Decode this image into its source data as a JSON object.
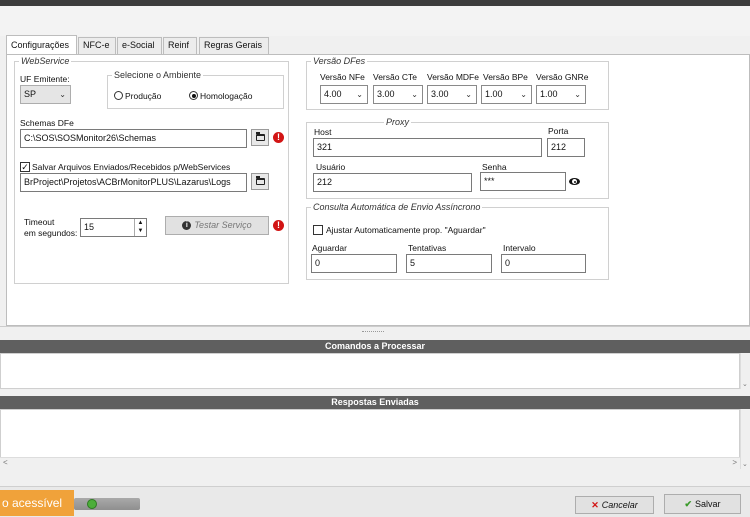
{
  "tabs": [
    "Configurações",
    "NFC-e",
    "e-Social",
    "Reinf",
    "Regras Gerais"
  ],
  "webservice": {
    "title": "WebService",
    "uf_label": "UF Emitente:",
    "uf_value": "SP",
    "ambiente_title": "Selecione o Ambiente",
    "radio_producao": "Produção",
    "radio_homologacao": "Homologação",
    "schemas_label": "Schemas DFe",
    "schemas_value": "C:\\SOS\\SOSMonitor26\\Schemas",
    "salvar_label": "Salvar Arquivos Enviados/Recebidos p/WebServices",
    "logs_value": "BrProject\\Projetos\\ACBrMonitorPLUS\\Lazarus\\Logs",
    "timeout_label_1": "Timeout",
    "timeout_label_2": "em segundos:",
    "timeout_value": "15",
    "testar_label": "Testar Serviço"
  },
  "versao": {
    "title": "Versão DFes",
    "labels": [
      "Versão NFe",
      "Versão CTe",
      "Versão MDFe",
      "Versão BPe",
      "Versão GNRe"
    ],
    "values": [
      "4.00",
      "3.00",
      "3.00",
      "1.00",
      "1.00"
    ]
  },
  "proxy": {
    "title": "Proxy",
    "host_label": "Host",
    "host_value": "321",
    "porta_label": "Porta",
    "porta_value": "212",
    "usuario_label": "Usuário",
    "usuario_value": "212",
    "senha_label": "Senha",
    "senha_value": "***"
  },
  "consulta": {
    "title": "Consulta Automática de Envio Assíncrono",
    "ajustar_label": "Ajustar Automaticamente prop. \"Aguardar\"",
    "aguardar_label": "Aguardar",
    "aguardar_value": "0",
    "tentativas_label": "Tentativas",
    "tentativas_value": "5",
    "intervalo_label": "Intervalo",
    "intervalo_value": "0"
  },
  "comandos_header": "Comandos a Processar",
  "respostas_header": "Respostas Enviadas",
  "footer": {
    "status_text": "o acessível",
    "cancel_label": "Cancelar",
    "save_label": "Salvar"
  },
  "icons": {
    "folder": "folder-icon",
    "warn": "error-icon",
    "eye": "eye-icon",
    "info": "info-icon",
    "cancel": "cancel-x-icon",
    "check": "check-icon"
  },
  "colors": {
    "status_orange": "#f0a23a",
    "error_red": "#d21414",
    "ok_green": "#3a9a2a",
    "header_gray": "#5f5f5f"
  }
}
